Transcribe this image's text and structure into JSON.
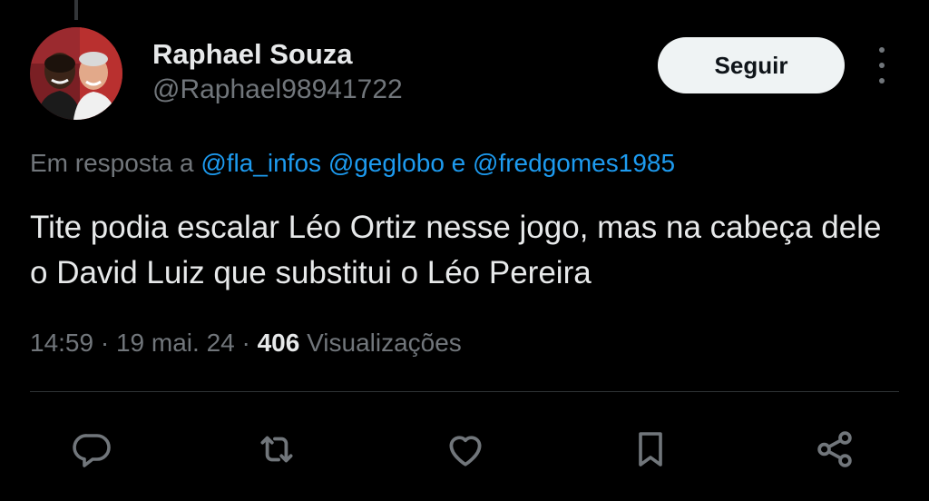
{
  "author": {
    "display_name": "Raphael Souza",
    "handle": "@Raphael98941722"
  },
  "header": {
    "follow_label": "Seguir"
  },
  "reply": {
    "prefix": "Em resposta a",
    "mention1": "@fla_infos",
    "mention2": "@geglobo",
    "joiner": "e",
    "mention3": "@fredgomes1985"
  },
  "tweet": {
    "text": "Tite podia escalar Léo Ortiz nesse jogo, mas na cabeça dele o David Luiz que substitui o Léo Pereira"
  },
  "meta": {
    "time": "14:59",
    "separator": "·",
    "date": "19 mai. 24",
    "views_count": "406",
    "views_label": "Visualizações"
  },
  "actions": {
    "icons": [
      "reply-icon",
      "retweet-icon",
      "like-icon",
      "bookmark-icon",
      "share-icon"
    ]
  },
  "colors": {
    "background": "#000000",
    "primary_text": "#e7e9ea",
    "secondary_text": "#71767b",
    "link": "#1d9bf0",
    "follow_button_bg": "#eff3f4"
  }
}
